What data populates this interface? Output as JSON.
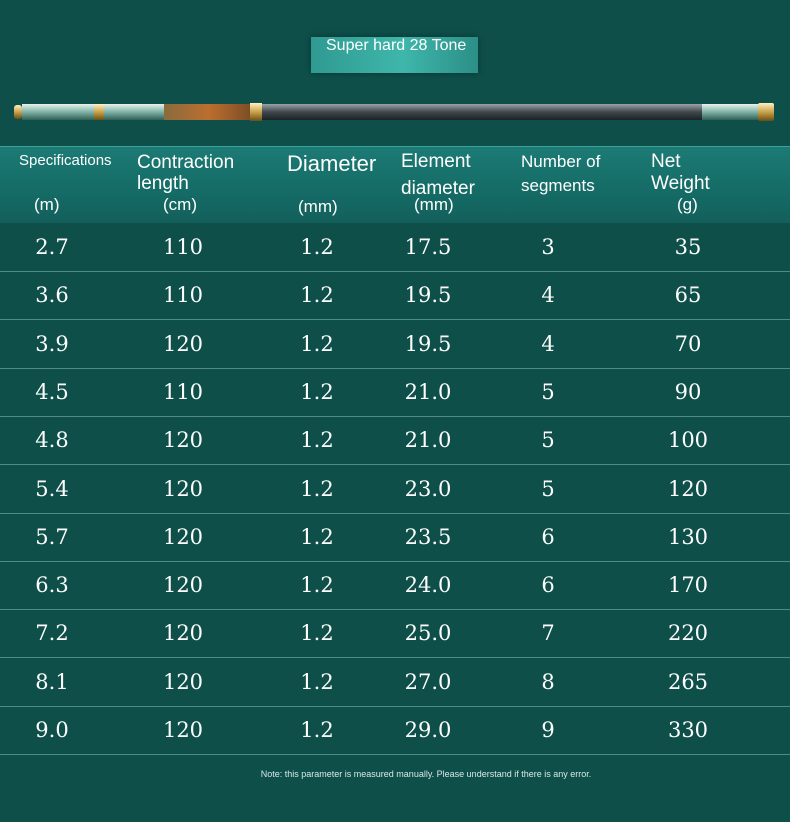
{
  "badge": {
    "text": "Super hard 28 Tone"
  },
  "header": {
    "specifications": "Specifications",
    "specifications_unit": "(m)",
    "contraction": "Contraction length",
    "contraction_unit": "(cm)",
    "diameter": "Diameter",
    "diameter_unit": "(mm)",
    "element": "Element diameter",
    "element_unit": "(mm)",
    "segments": "Number of segments",
    "weight": "Net Weight",
    "weight_unit": "(g)"
  },
  "rows": [
    [
      "2.7",
      "110",
      "1.2",
      "17.5",
      "3",
      "35"
    ],
    [
      "3.6",
      "110",
      "1.2",
      "19.5",
      "4",
      "65"
    ],
    [
      "3.9",
      "120",
      "1.2",
      "19.5",
      "4",
      "70"
    ],
    [
      "4.5",
      "110",
      "1.2",
      "21.0",
      "5",
      "90"
    ],
    [
      "4.8",
      "120",
      "1.2",
      "21.0",
      "5",
      "100"
    ],
    [
      "5.4",
      "120",
      "1.2",
      "23.0",
      "5",
      "120"
    ],
    [
      "5.7",
      "120",
      "1.2",
      "23.5",
      "6",
      "130"
    ],
    [
      "6.3",
      "120",
      "1.2",
      "24.0",
      "6",
      "170"
    ],
    [
      "7.2",
      "120",
      "1.2",
      "25.0",
      "7",
      "220"
    ],
    [
      "8.1",
      "120",
      "1.2",
      "27.0",
      "8",
      "265"
    ],
    [
      "9.0",
      "120",
      "1.2",
      "29.0",
      "9",
      "330"
    ]
  ],
  "note": "Note: this parameter is measured manually. Please understand if there is any error."
}
